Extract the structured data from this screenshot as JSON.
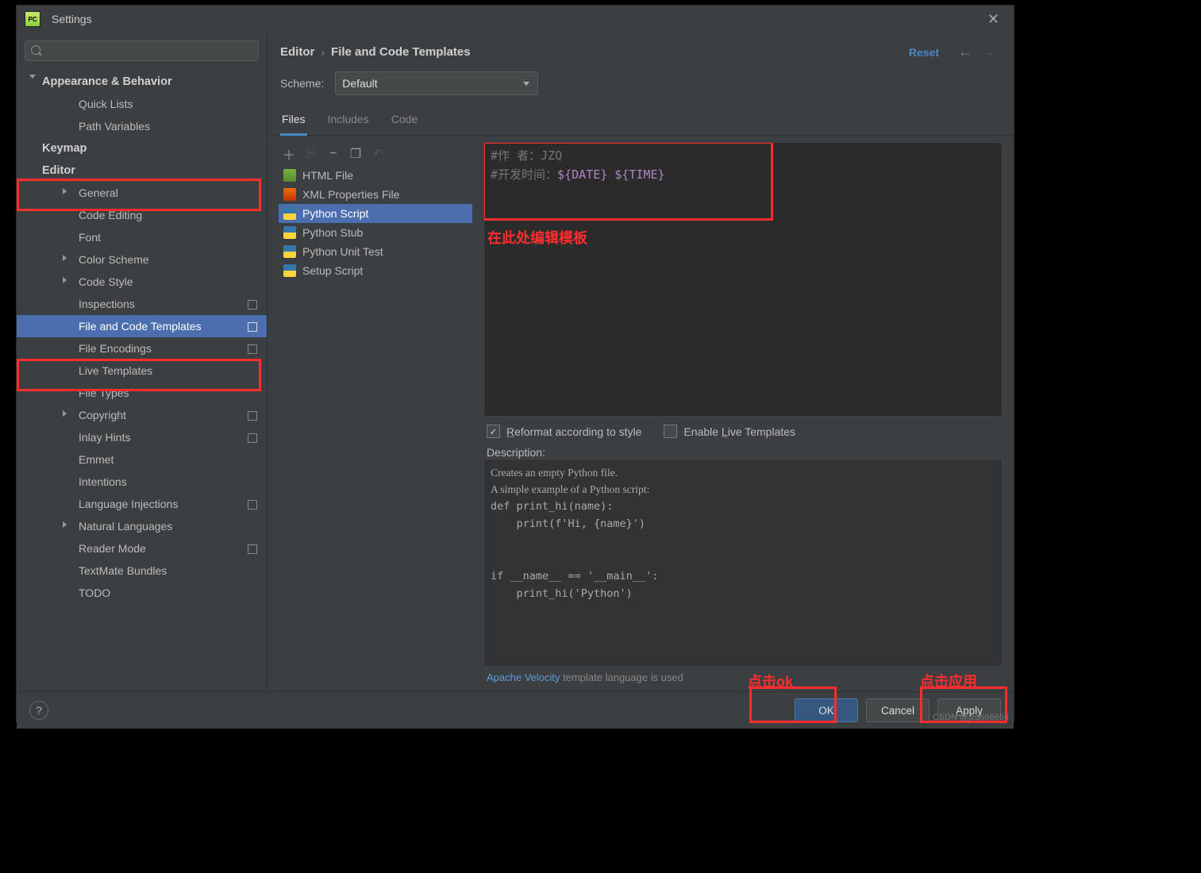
{
  "titlebar": {
    "title": "Settings"
  },
  "search": {
    "placeholder": ""
  },
  "sidebar": {
    "cat_appearance": "Appearance & Behavior",
    "quick_lists": "Quick Lists",
    "path_vars": "Path Variables",
    "keymap": "Keymap",
    "editor": "Editor",
    "general": "General",
    "code_editing": "Code Editing",
    "font": "Font",
    "color_scheme": "Color Scheme",
    "code_style": "Code Style",
    "inspections": "Inspections",
    "file_code_templates": "File and Code Templates",
    "file_encodings": "File Encodings",
    "live_templates": "Live Templates",
    "file_types": "File Types",
    "copyright": "Copyright",
    "inlay_hints": "Inlay Hints",
    "emmet": "Emmet",
    "intentions": "Intentions",
    "lang_inj": "Language Injections",
    "nat_lang": "Natural Languages",
    "reader_mode": "Reader Mode",
    "textmate": "TextMate Bundles",
    "todo": "TODO"
  },
  "breadcrumb": {
    "a": "Editor",
    "b": "File and Code Templates",
    "reset": "Reset"
  },
  "scheme": {
    "label": "Scheme:",
    "value": "Default"
  },
  "tabs": {
    "files": "Files",
    "includes": "Includes",
    "code": "Code"
  },
  "filelist": {
    "html": "HTML File",
    "xml": "XML Properties File",
    "py": "Python Script",
    "stub": "Python Stub",
    "unit": "Python Unit Test",
    "setup": "Setup Script"
  },
  "editor": {
    "line1_a": "#作    者：",
    "line1_b": "JZQ",
    "line2_a": "#开发时间：",
    "line2_b": "${DATE} ${TIME}"
  },
  "annot": {
    "edit_here": "在此处编辑模板",
    "click_ok": "点击ok",
    "click_apply": "点击应用"
  },
  "checks": {
    "reformat_pre": "R",
    "reformat": "eformat according to style",
    "enable_pre": "Enable ",
    "enable_u": "L",
    "enable_post": "ive Templates"
  },
  "desc": {
    "label": "Description:",
    "l1": "Creates an empty Python file.",
    "l2": "A simple example of a Python script:",
    "l3": "def print_hi(name):",
    "l4": "    print(f'Hi, {name}')",
    "l5": "",
    "l6": "",
    "l7": "if __name__ == '__main__':",
    "l8": "    print_hi('Python')"
  },
  "velocity": {
    "link": "Apache Velocity",
    "rest": " template language is used"
  },
  "buttons": {
    "ok": "OK",
    "cancel": "Cancel",
    "apply_u": "A",
    "apply": "pply"
  },
  "watermark": "CSDN @jzq666666"
}
